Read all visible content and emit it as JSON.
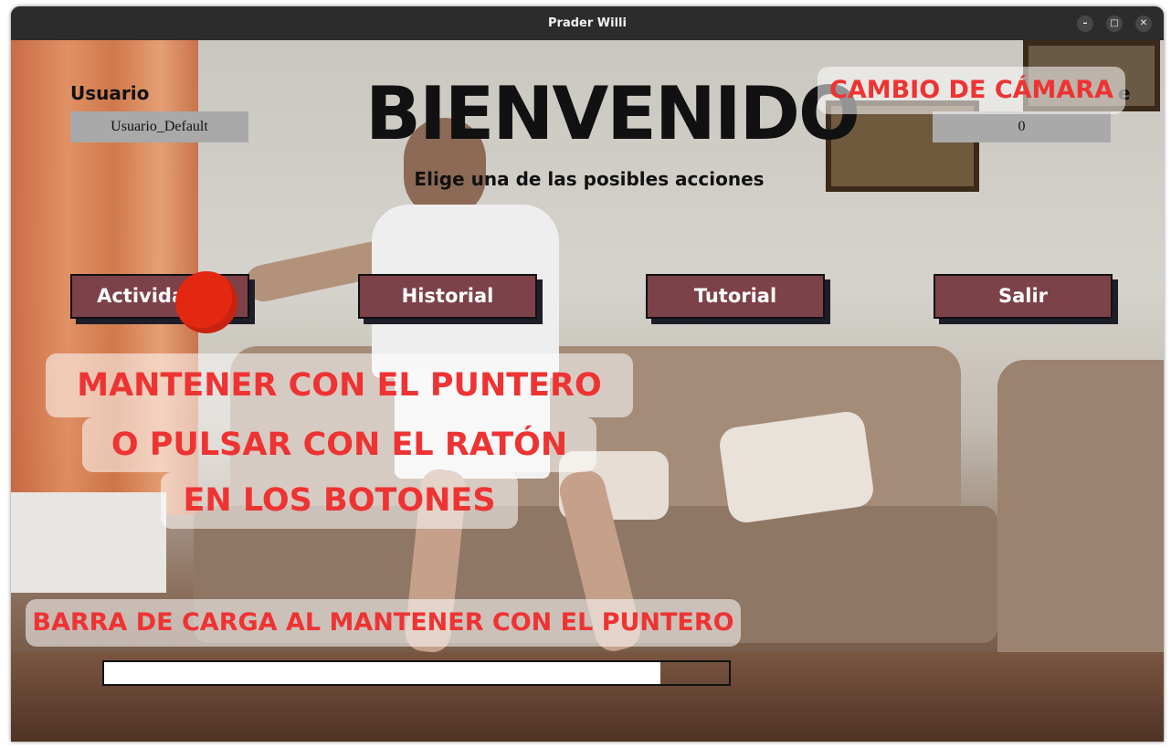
{
  "window": {
    "title": "Prader Willi",
    "minimize_glyph": "–",
    "maximize_glyph": "□",
    "close_glyph": "✕"
  },
  "header": {
    "title": "BIENVENIDO",
    "subtitle": "Elige una de las posibles acciones"
  },
  "user": {
    "label": "Usuario",
    "value": "Usuario_Default"
  },
  "right_field": {
    "label_fragment": "e",
    "value": "0"
  },
  "buttons": [
    {
      "label": "Actividades"
    },
    {
      "label": "Historial"
    },
    {
      "label": "Tutorial"
    },
    {
      "label": "Salir"
    }
  ],
  "annotations": {
    "camera": "CAMBIO DE CÁMARA",
    "hold_lines": [
      "MANTENER CON EL PUNTERO",
      "O PULSAR CON EL RATÓN",
      "EN LOS BOTONES"
    ],
    "loading_bar": "BARRA DE CARGA AL MANTENER CON EL PUNTERO"
  },
  "progress": {
    "fraction": 0.89
  },
  "colors": {
    "button": "#7c4149",
    "pointer": "#e32812",
    "annotation_text": "#ee3333"
  }
}
